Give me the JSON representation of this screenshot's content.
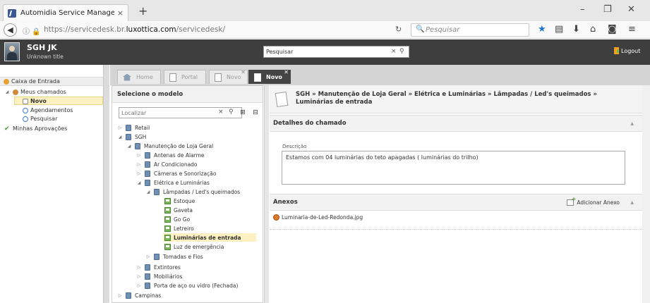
{
  "browser": {
    "tab_title": "Automidia Service Managem",
    "tab_close": "×",
    "new_tab": "+",
    "url_prefix": "https://servicedesk.br.",
    "url_domain": "luxottica.com",
    "url_path": "/servicedesk/",
    "search_placeholder": "Pesquisar",
    "win_min": "–",
    "win_max": "❐",
    "win_close": "✕"
  },
  "header": {
    "user_name": "SGH JK",
    "user_title": "Unknown title",
    "search_value": "Pesquisar",
    "logout_label": "Logout"
  },
  "leftnav": {
    "inbox": "Caixa de Entrada",
    "my_tickets": "Meus chamados",
    "novo": "Novo",
    "agendamentos": "Agendamentos",
    "pesquisar": "Pesquisar",
    "aprovacoes": "Minhas Aprovações"
  },
  "tabs": [
    {
      "label": "Home"
    },
    {
      "label": "Portal"
    },
    {
      "label": "Novo"
    },
    {
      "label": "Novo"
    }
  ],
  "model": {
    "title": "Selecione o modelo",
    "search_placeholder": "Localizar",
    "tree": [
      {
        "label": "Retail"
      },
      {
        "label": "SGH"
      },
      {
        "label": "Manutenção de Loja Geral"
      },
      {
        "label": "Antenas de Alarme"
      },
      {
        "label": "Ar Condicionado"
      },
      {
        "label": "Câmeras e Sonorização"
      },
      {
        "label": "Elétrica e Luminárias"
      },
      {
        "label": "Lâmpadas / Led's queimados"
      },
      {
        "label": "Estoque"
      },
      {
        "label": "Gaveta"
      },
      {
        "label": "Go Go"
      },
      {
        "label": "Letreiro"
      },
      {
        "label": "Luminárias de entrada"
      },
      {
        "label": "Luz de emergência"
      },
      {
        "label": "Tomadas e Fios"
      },
      {
        "label": "Extintores"
      },
      {
        "label": "Mobiliários"
      },
      {
        "label": "Porta de aço ou vidro (Fechada)"
      },
      {
        "label": "Campinas"
      }
    ]
  },
  "detail": {
    "path": "SGH » Manutenção de Loja Geral » Elétrica e Luminárias » Lâmpadas / Led's queimados » Luminárias de entrada",
    "details_title": "Detalhes do chamado",
    "desc_label": "Descrição",
    "desc_value": "Estamos com 04 luminárias do teto apagadas ( luminárias do trilho)",
    "attachments_title": "Anexos",
    "add_attachment": "Adicionar Anexo",
    "attachment_file": "Luminaria-de-Led-Redonda.jpg"
  }
}
